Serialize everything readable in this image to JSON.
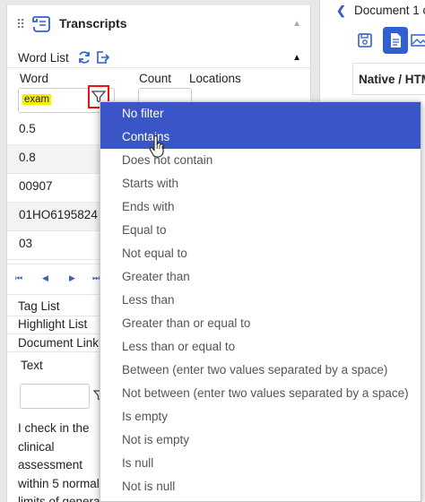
{
  "transcripts_panel": {
    "title": "Transcripts",
    "word_list_label": "Word List",
    "columns": {
      "word": "Word",
      "count": "Count",
      "locations": "Locations"
    },
    "word_filter_value": "exam",
    "words": [
      "0.5",
      "0.8",
      "00907",
      "01HO6195824",
      "03"
    ],
    "pager": {
      "first": "⏮",
      "prev": "◀",
      "next": "▶",
      "last": "⏭"
    },
    "sections": [
      "Tag List",
      "Highlight List",
      "Document Link"
    ],
    "text_label": "Text",
    "text_preview_lines": [
      "I check in the",
      "clinical",
      "assessment",
      "within 5 normal",
      "limits of genera"
    ]
  },
  "document_panel": {
    "title": "Document 1 c",
    "native_tab_label": "Native / HTM"
  },
  "filter_menu": {
    "items": [
      "No filter",
      "Contains",
      "Does not contain",
      "Starts with",
      "Ends with",
      "Equal to",
      "Not equal to",
      "Greater than",
      "Less than",
      "Greater than or equal to",
      "Less than or equal to",
      "Between (enter two values separated by a space)",
      "Not between (enter two values separated by a space)",
      "Is empty",
      "Not is empty",
      "Is null",
      "Not is null"
    ],
    "selected_index": 0,
    "hover_index": 1
  },
  "colors": {
    "accent": "#3a55c8",
    "highlight": "#f7f000",
    "filter_outline": "#e11111",
    "link_blue": "#3b5fc0"
  }
}
